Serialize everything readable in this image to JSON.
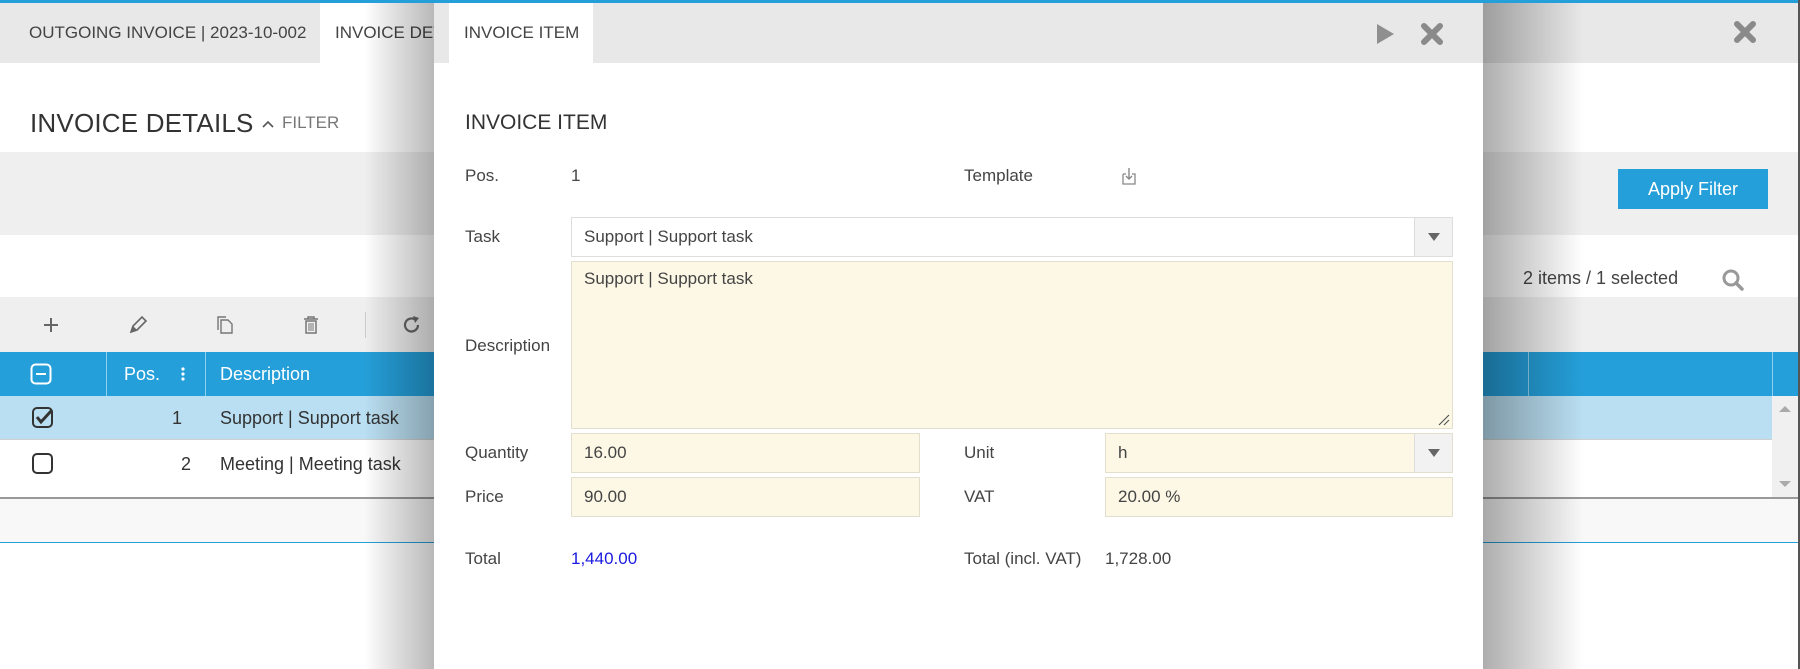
{
  "background_page": {
    "tabs": [
      {
        "label": "OUTGOING INVOICE | 2023-10-002",
        "active": false
      },
      {
        "label": "INVOICE DETAILS",
        "active": true
      }
    ],
    "title": "INVOICE DETAILS",
    "filter_toggle_label": "FILTER",
    "apply_filter_label": "Apply Filter",
    "items_status": "2 items / 1 selected",
    "toolbar_icons": [
      "plus-icon",
      "pencil-icon",
      "copy-icon",
      "trash-icon",
      "refresh-icon"
    ],
    "grid": {
      "columns": [
        "Pos.",
        "Description"
      ],
      "rows": [
        {
          "selected": true,
          "pos": "1",
          "description": "Support | Support task"
        },
        {
          "selected": false,
          "pos": "2",
          "description": "Meeting | Meeting task"
        }
      ]
    }
  },
  "modal": {
    "tab_label": "INVOICE ITEM",
    "title": "INVOICE ITEM",
    "fields": {
      "pos": {
        "label": "Pos.",
        "value": "1"
      },
      "template": {
        "label": "Template"
      },
      "task": {
        "label": "Task",
        "value": "Support | Support task"
      },
      "description": {
        "label": "Description",
        "value": "Support | Support task"
      },
      "quantity": {
        "label": "Quantity",
        "value": "16.00"
      },
      "unit": {
        "label": "Unit",
        "value": "h"
      },
      "price": {
        "label": "Price",
        "value": "90.00"
      },
      "vat": {
        "label": "VAT",
        "value": "20.00 %"
      },
      "total": {
        "label": "Total",
        "value": "1,440.00"
      },
      "total_incl_vat": {
        "label": "Total (incl. VAT)",
        "value": "1,728.00"
      }
    }
  },
  "colors": {
    "accent": "#259fd9",
    "selected_row": "#badff2",
    "input_bg": "#fdf8e6",
    "total_link": "#1a1ae0"
  }
}
